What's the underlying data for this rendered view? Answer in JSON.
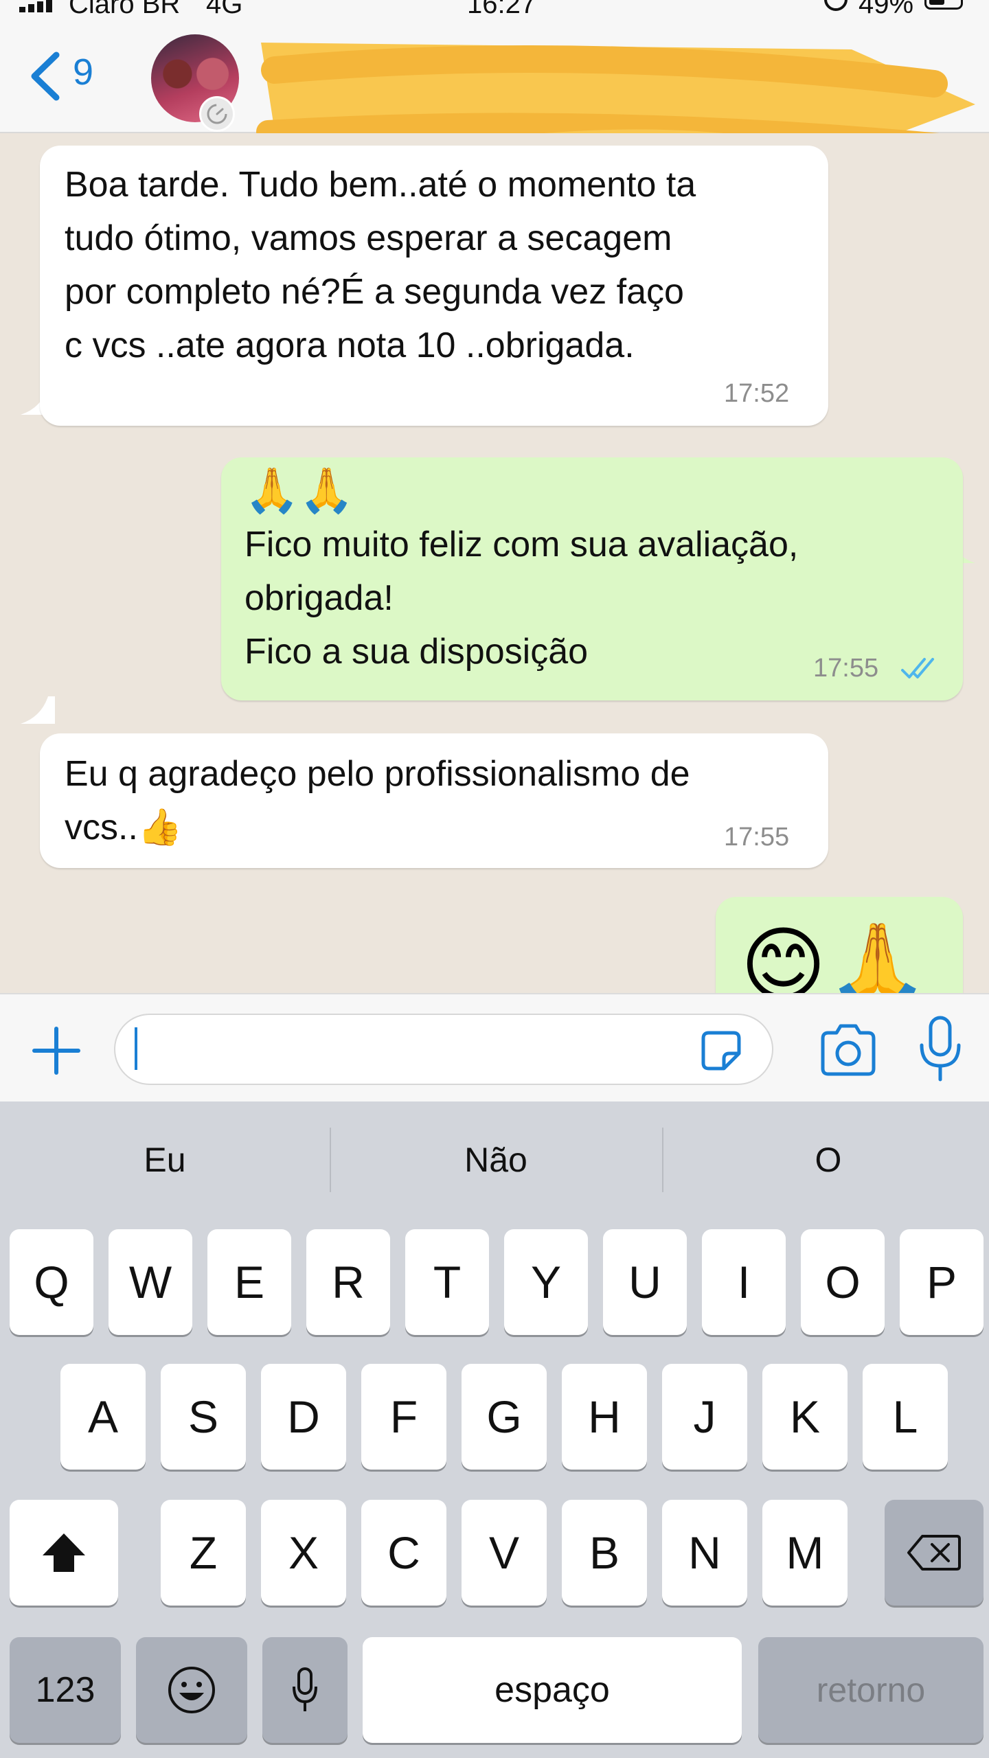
{
  "status_bar": {
    "carrier": "Claro BR",
    "network": "4G",
    "time": "16:27",
    "battery": "49%"
  },
  "header": {
    "back_count": "9"
  },
  "messages": [
    {
      "direction": "incoming",
      "text": "Boa tarde. Tudo bem..até o momento ta\ntudo ótimo, vamos esperar a secagem\npor completo né?É a segunda vez faço\nc vcs ..ate agora nota 10 ..obrigada.",
      "time": "17:52"
    },
    {
      "direction": "outgoing",
      "emoji": "🙏🙏",
      "text": "Fico muito feliz com sua avaliação,\nobrigada!\nFico a sua disposição",
      "time": "17:55",
      "status": "read"
    },
    {
      "direction": "incoming",
      "text": "Eu q agradeço pelo profissionalismo de\nvcs..👍",
      "time": "17:55"
    },
    {
      "direction": "outgoing",
      "emoji": "😊🙏",
      "partial": true
    }
  ],
  "input": {
    "value": ""
  },
  "keyboard": {
    "suggestions": [
      "Eu",
      "Não",
      "O"
    ],
    "row1": [
      "Q",
      "W",
      "E",
      "R",
      "T",
      "Y",
      "U",
      "I",
      "O",
      "P"
    ],
    "row2": [
      "A",
      "S",
      "D",
      "F",
      "G",
      "H",
      "J",
      "K",
      "L"
    ],
    "row3": [
      "Z",
      "X",
      "C",
      "V",
      "B",
      "N",
      "M"
    ],
    "numbers_key": "123",
    "space_key": "espaço",
    "return_key": "retorno"
  },
  "colors": {
    "accent": "#1a7fd4",
    "outgoing_bubble": "#dcf8c6",
    "incoming_bubble": "#ffffff",
    "chat_background": "#ece5dc",
    "read_ticks": "#4fb6ec",
    "redaction": "#f9c74f"
  }
}
